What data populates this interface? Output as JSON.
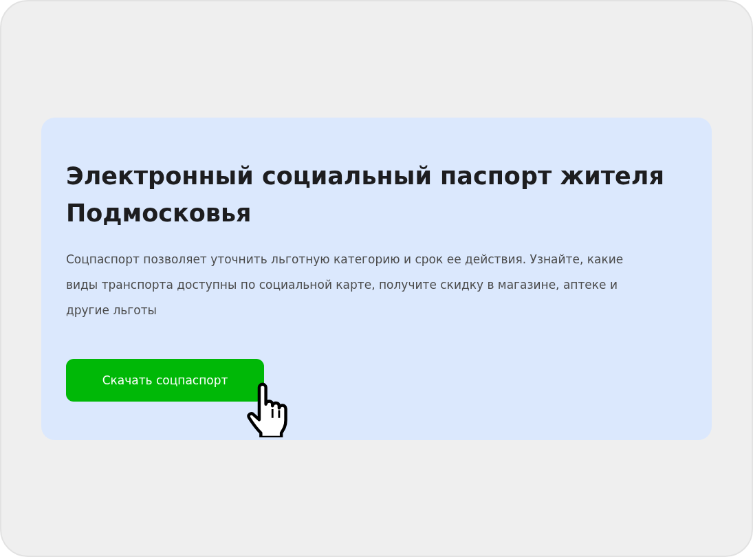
{
  "card": {
    "title": "Электронный социальный паспорт жителя Подмосковья",
    "description": "Соцпаспорт позволяет уточнить льготную категорию и срок ее действия. Узнайте, какие виды транспорта доступны по социальной карте, получите скидку в магазине, аптеке и другие льготы",
    "button": {
      "label": "Скачать соцпаспорт"
    }
  }
}
